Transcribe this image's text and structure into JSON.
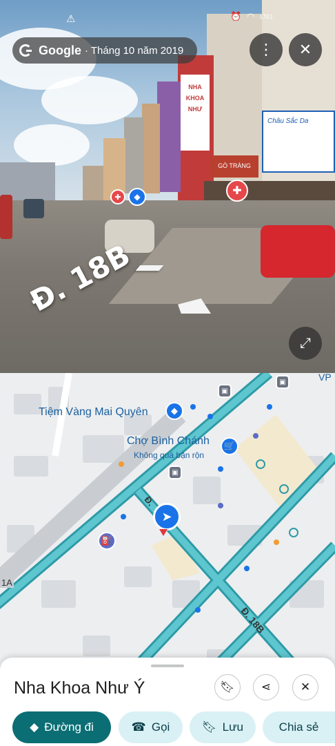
{
  "status_bar": {
    "warning_icon": "warning-icon",
    "network": "LTE1",
    "volte": "Vo))"
  },
  "street_view": {
    "brand": "Google",
    "capture_date": "· Tháng 10 năm 2019",
    "road_label": "Đ. 18B",
    "shop_signs": [
      "NHA KHOA NHƯ",
      "Châu Sắc Da",
      "GÒ TRÀNG"
    ],
    "more_icon": "more-vert-icon",
    "close_icon": "close-icon",
    "expand_icon": "expand-icon"
  },
  "map": {
    "labels": {
      "jewelry": "Tiệm Vàng Mai Quyên",
      "market": "Chợ Bình Chánh",
      "market_sub": "Không quá bận rộn",
      "road_18b": "Đ. 18B",
      "road_d": "Đ.",
      "highway": "1A",
      "corner": "VP"
    },
    "colors": {
      "road": "#5ec6cf",
      "road_edge": "#2e9aa6",
      "block": "#d6d9de",
      "land": "#f1f3f4"
    }
  },
  "place": {
    "name": "Nha Khoa Như Ý",
    "save_icon": "bookmark-icon",
    "share_icon": "share-icon",
    "close_icon": "close-icon"
  },
  "actions": {
    "directions": "Đường đi",
    "call": "Gọi",
    "save": "Lưu",
    "more": "Chia sẻ"
  }
}
